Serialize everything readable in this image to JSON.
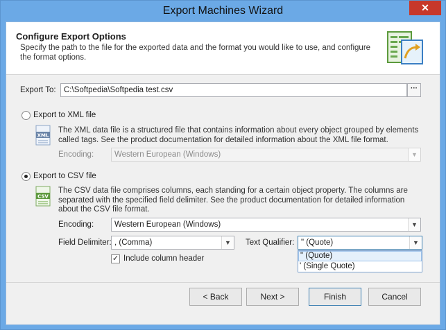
{
  "window": {
    "title": "Export Machines Wizard",
    "close_glyph": "✕"
  },
  "header": {
    "title": "Configure Export Options",
    "description": "Specify the path to the file for the exported data and the format you would like to use, and configure the format options.",
    "icon": "export-document-icon"
  },
  "export_to": {
    "label": "Export To:",
    "value": "C:\\Softpedia\\Softpedia test.csv",
    "browse_label": "···"
  },
  "xml": {
    "radio_label": "Export to XML file",
    "selected": false,
    "icon_text": "XML",
    "description": "The XML data file is a structured file that contains information about every object grouped by elements called tags. See the product documentation for detailed information about the XML file format.",
    "encoding_label": "Encoding:",
    "encoding_value": "Western European (Windows)"
  },
  "csv": {
    "radio_label": "Export to CSV file",
    "selected": true,
    "icon_text": "CSV",
    "description": "The CSV data file comprises columns, each standing for a certain object property. The columns are separated with the specified field delimiter. See the product documentation for detailed information about the CSV file format.",
    "encoding_label": "Encoding:",
    "encoding_value": "Western European (Windows)",
    "delimiter_label": "Field Delimiter:",
    "delimiter_value": ", (Comma)",
    "qualifier_label": "Text Qualifier:",
    "qualifier_value": "\" (Quote)",
    "qualifier_options": [
      "\" (Quote)",
      "' (Single Quote)"
    ],
    "include_header_label": "Include column header",
    "include_header_checked": true,
    "check_glyph": "✓"
  },
  "buttons": {
    "back": "< Back",
    "next": "Next >",
    "finish": "Finish",
    "cancel": "Cancel"
  },
  "arrow_glyph": "▼"
}
